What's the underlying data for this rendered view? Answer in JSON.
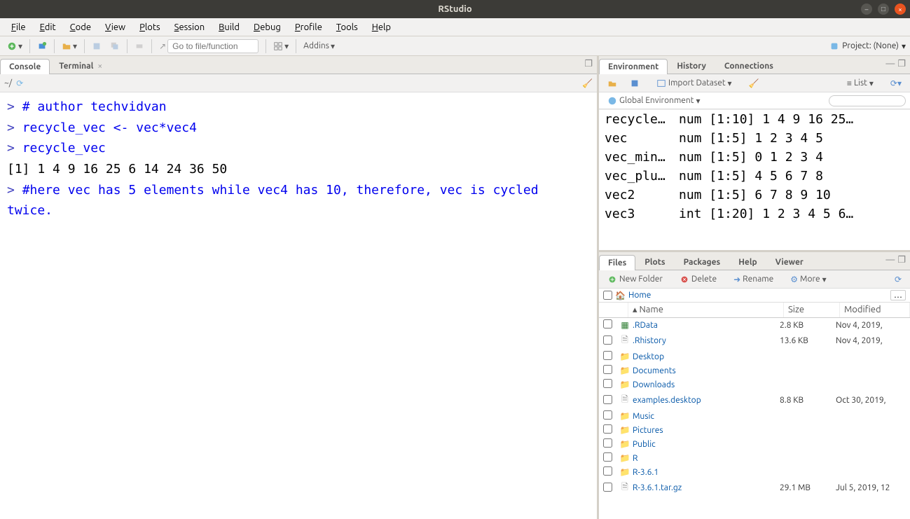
{
  "window": {
    "title": "RStudio"
  },
  "menubar": [
    "File",
    "Edit",
    "Code",
    "View",
    "Plots",
    "Session",
    "Build",
    "Debug",
    "Profile",
    "Tools",
    "Help"
  ],
  "toolbar": {
    "goto_placeholder": "Go to file/function",
    "addins_label": "Addins",
    "project_label": "Project: (None)"
  },
  "console": {
    "tab_console": "Console",
    "tab_terminal": "Terminal",
    "path": "~/",
    "lines": [
      {
        "type": "cmd",
        "text": "# author techvidvan"
      },
      {
        "type": "cmd",
        "text": "recycle_vec <- vec*vec4"
      },
      {
        "type": "cmd",
        "text": "recycle_vec"
      },
      {
        "type": "out",
        "text": " [1]  1  4  9 16 25  6 14 24 36 50"
      },
      {
        "type": "cmd",
        "text": "#here vec has 5 elements while vec4 has 10, therefore, vec is cycled twice."
      }
    ]
  },
  "env_tabs": {
    "environment": "Environment",
    "history": "History",
    "connections": "Connections"
  },
  "env_toolbar": {
    "import": "Import Dataset",
    "global": "Global Environment",
    "list": "List"
  },
  "env_rows": [
    {
      "name": "recycle…",
      "value": "num [1:10] 1 4 9 16 25…"
    },
    {
      "name": "vec",
      "value": "num [1:5] 1 2 3 4 5"
    },
    {
      "name": "vec_min…",
      "value": "num [1:5] 0 1 2 3 4"
    },
    {
      "name": "vec_plu…",
      "value": "num [1:5] 4 5 6 7 8"
    },
    {
      "name": "vec2",
      "value": "num [1:5] 6 7 8 9 10"
    },
    {
      "name": "vec3",
      "value": "int [1:20] 1 2 3 4 5 6…"
    }
  ],
  "files_tabs": {
    "files": "Files",
    "plots": "Plots",
    "packages": "Packages",
    "help": "Help",
    "viewer": "Viewer"
  },
  "files_toolbar": {
    "new_folder": "New Folder",
    "delete": "Delete",
    "rename": "Rename",
    "more": "More"
  },
  "files_breadcrumb": "Home",
  "files_cols": {
    "name": "Name",
    "size": "Size",
    "modified": "Modified"
  },
  "files_rows": [
    {
      "icon": "rdata",
      "name": ".RData",
      "size": "2.8 KB",
      "modified": "Nov 4, 2019,"
    },
    {
      "icon": "file",
      "name": ".Rhistory",
      "size": "13.6 KB",
      "modified": "Nov 4, 2019,"
    },
    {
      "icon": "folder",
      "name": "Desktop",
      "size": "",
      "modified": ""
    },
    {
      "icon": "folder",
      "name": "Documents",
      "size": "",
      "modified": ""
    },
    {
      "icon": "folder",
      "name": "Downloads",
      "size": "",
      "modified": ""
    },
    {
      "icon": "file",
      "name": "examples.desktop",
      "size": "8.8 KB",
      "modified": "Oct 30, 2019,"
    },
    {
      "icon": "folder",
      "name": "Music",
      "size": "",
      "modified": ""
    },
    {
      "icon": "folder",
      "name": "Pictures",
      "size": "",
      "modified": ""
    },
    {
      "icon": "folder",
      "name": "Public",
      "size": "",
      "modified": ""
    },
    {
      "icon": "folder",
      "name": "R",
      "size": "",
      "modified": ""
    },
    {
      "icon": "folder",
      "name": "R-3.6.1",
      "size": "",
      "modified": ""
    },
    {
      "icon": "file",
      "name": "R-3.6.1.tar.gz",
      "size": "29.1 MB",
      "modified": "Jul 5, 2019, 12"
    }
  ]
}
